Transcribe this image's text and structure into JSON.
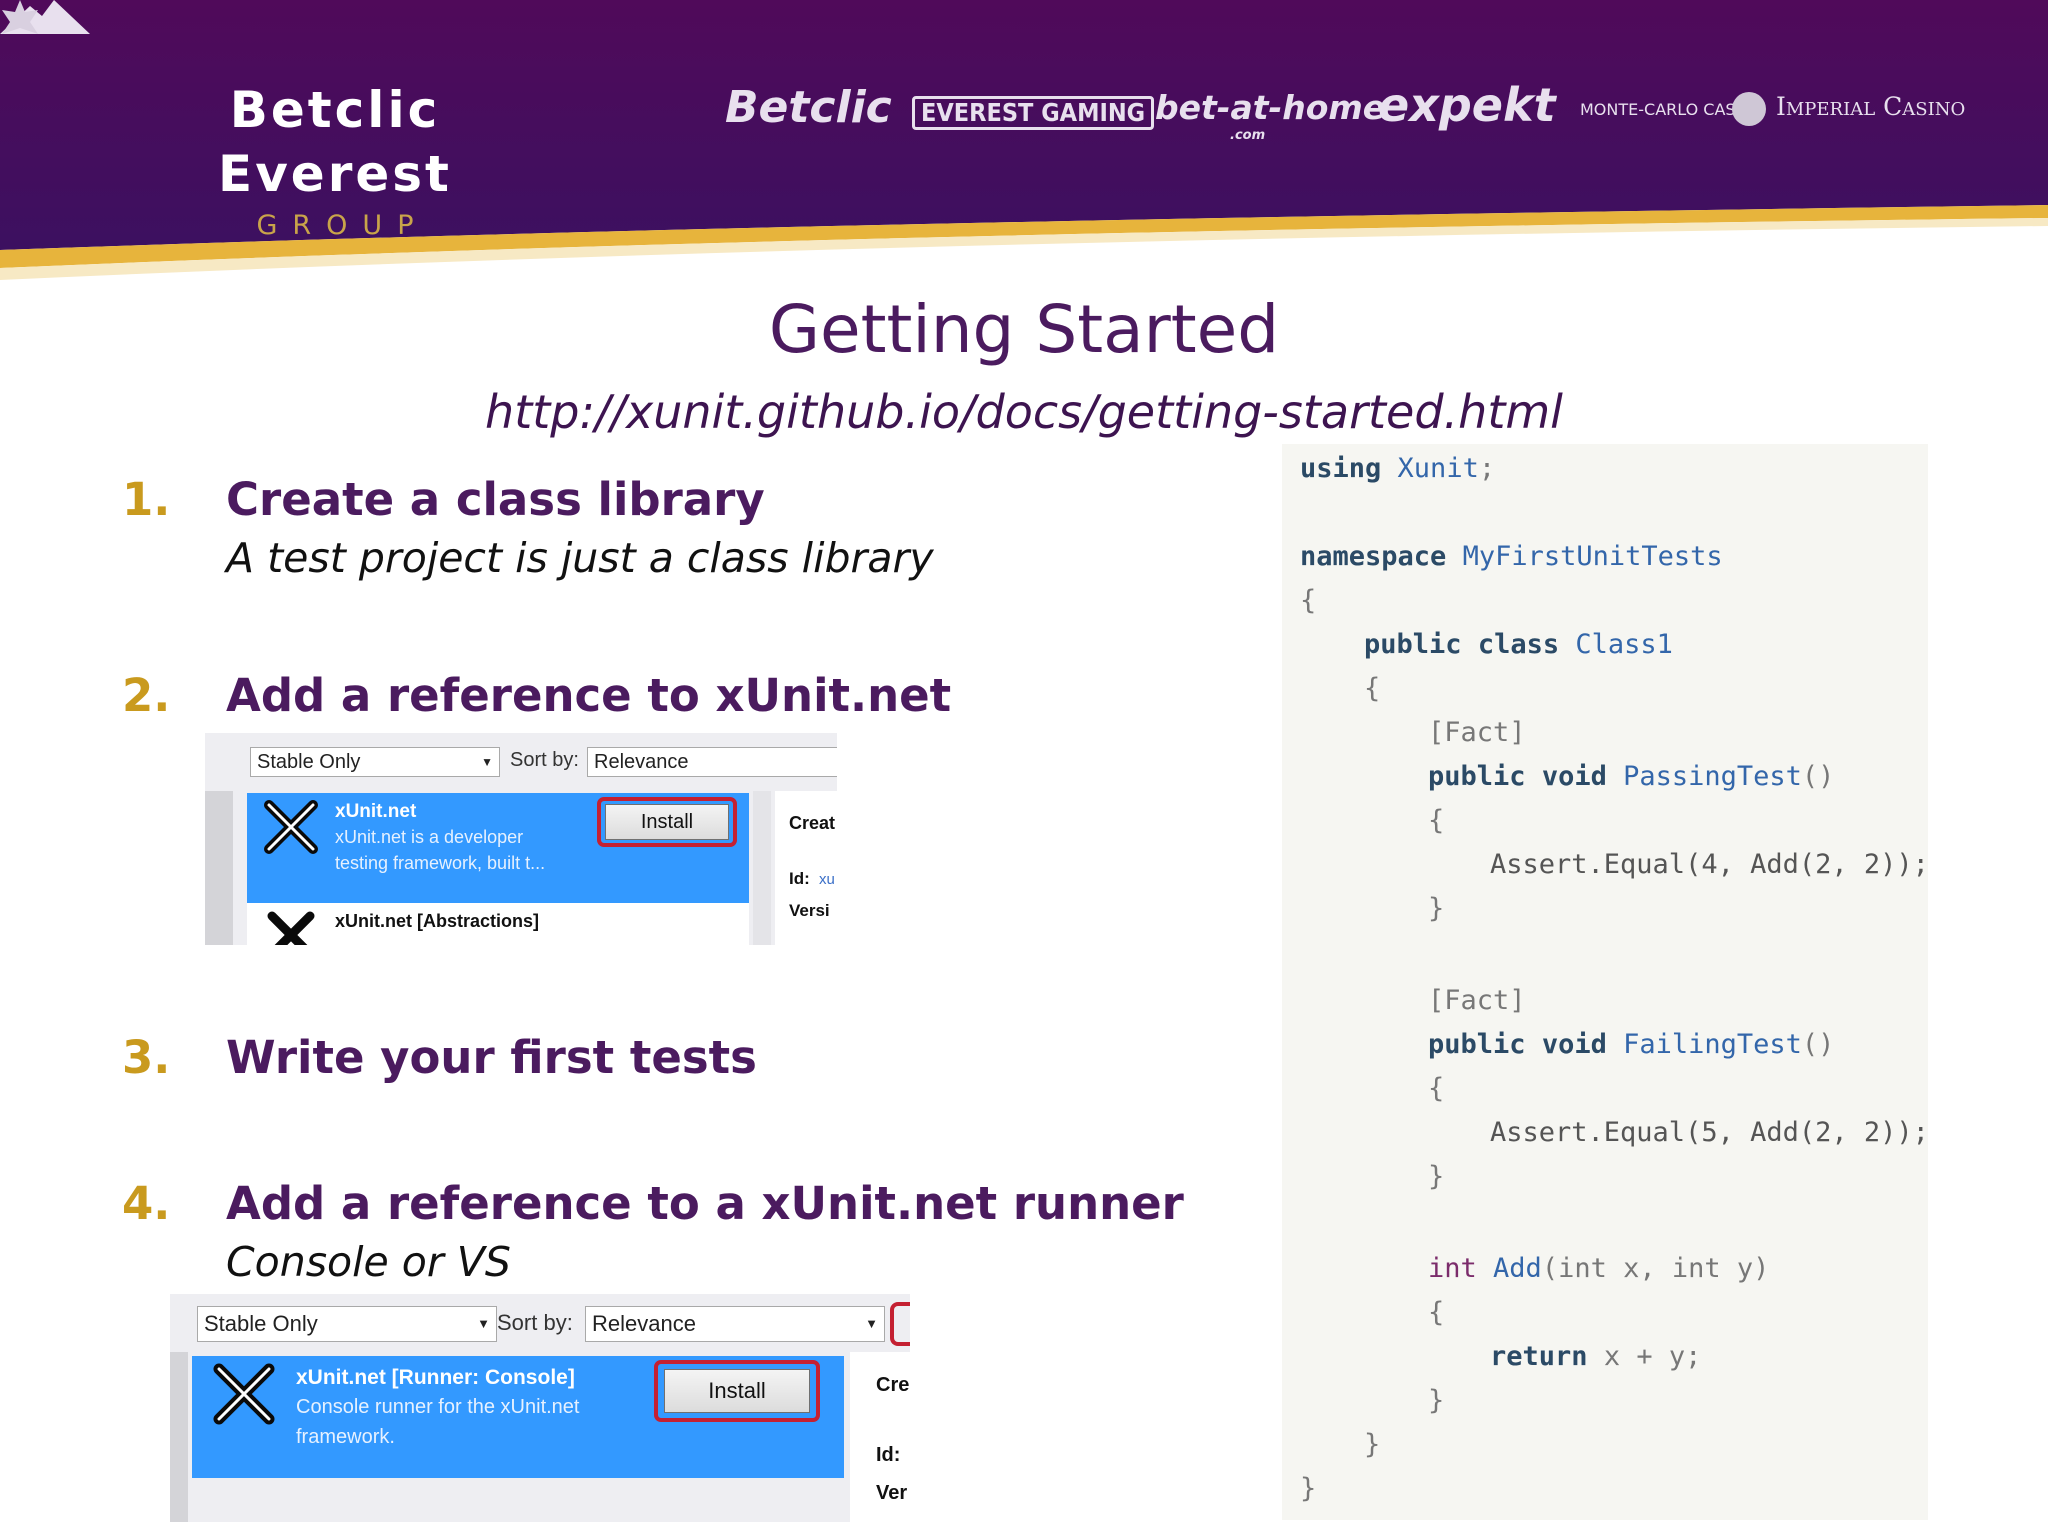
{
  "header": {
    "brand_name": "Betclic Everest",
    "brand_sub": "GROUP",
    "logos": [
      "Betclic",
      "EVEREST GAMING",
      "bet-at-home",
      ".com",
      "expekt",
      "MONTE-CARLO CASINO",
      "Imperial Casino"
    ],
    "colors": {
      "banner": "#4e0c58",
      "gold_stripe": "#e7b43c"
    }
  },
  "title": "Getting Started",
  "url": "http://xunit.github.io/docs/getting-started.html",
  "steps": [
    {
      "num": "1.",
      "title": "Create a class library",
      "subtitle": "A test project is just a class library"
    },
    {
      "num": "2.",
      "title": "Add a reference to xUnit.net"
    },
    {
      "num": "3.",
      "title": "Write your first tests"
    },
    {
      "num": "4.",
      "title": "Add a reference to a xUnit.net runner",
      "subtitle": "Console or VS"
    }
  ],
  "nuget1": {
    "filter": "Stable Only",
    "sort_label": "Sort by:",
    "sort_value": "Relevance",
    "pkg_name": "xUnit.net",
    "pkg_desc1": "xUnit.net is a developer",
    "pkg_desc2": "testing framework, built t...",
    "install": "Install",
    "pkg2_name": "xUnit.net [Abstractions]",
    "side_create": "Creat",
    "side_id": "Id:",
    "side_id_val": "xu",
    "side_version": "Versi"
  },
  "nuget2": {
    "filter": "Stable Only",
    "sort_label": "Sort by:",
    "sort_value": "Relevance",
    "pkg_name": "xUnit.net [Runner: Console]",
    "pkg_desc1": "Console runner for the xUnit.net",
    "pkg_desc2": "framework.",
    "install": "Install",
    "side_create": "Cre",
    "side_id": "Id:",
    "side_version": "Ver"
  },
  "code": {
    "l1a": "using",
    "l1b": "Xunit",
    "l1c": ";",
    "l2a": "namespace",
    "l2b": "MyFirstUnitTests",
    "brace_open": "{",
    "brace_close": "}",
    "public": "public",
    "class": "class",
    "class_name": "Class1",
    "fact": "[Fact]",
    "void": "void",
    "m1": "PassingTest",
    "m2": "FailingTest",
    "parens": "()",
    "assert1": "Assert.Equal(4, Add(2, 2));",
    "assert2": "Assert.Equal(5, Add(2, 2));",
    "int": "int",
    "add_name": "Add",
    "add_args": "(int x, int y)",
    "return": "return",
    "return_expr": "x + y;"
  }
}
